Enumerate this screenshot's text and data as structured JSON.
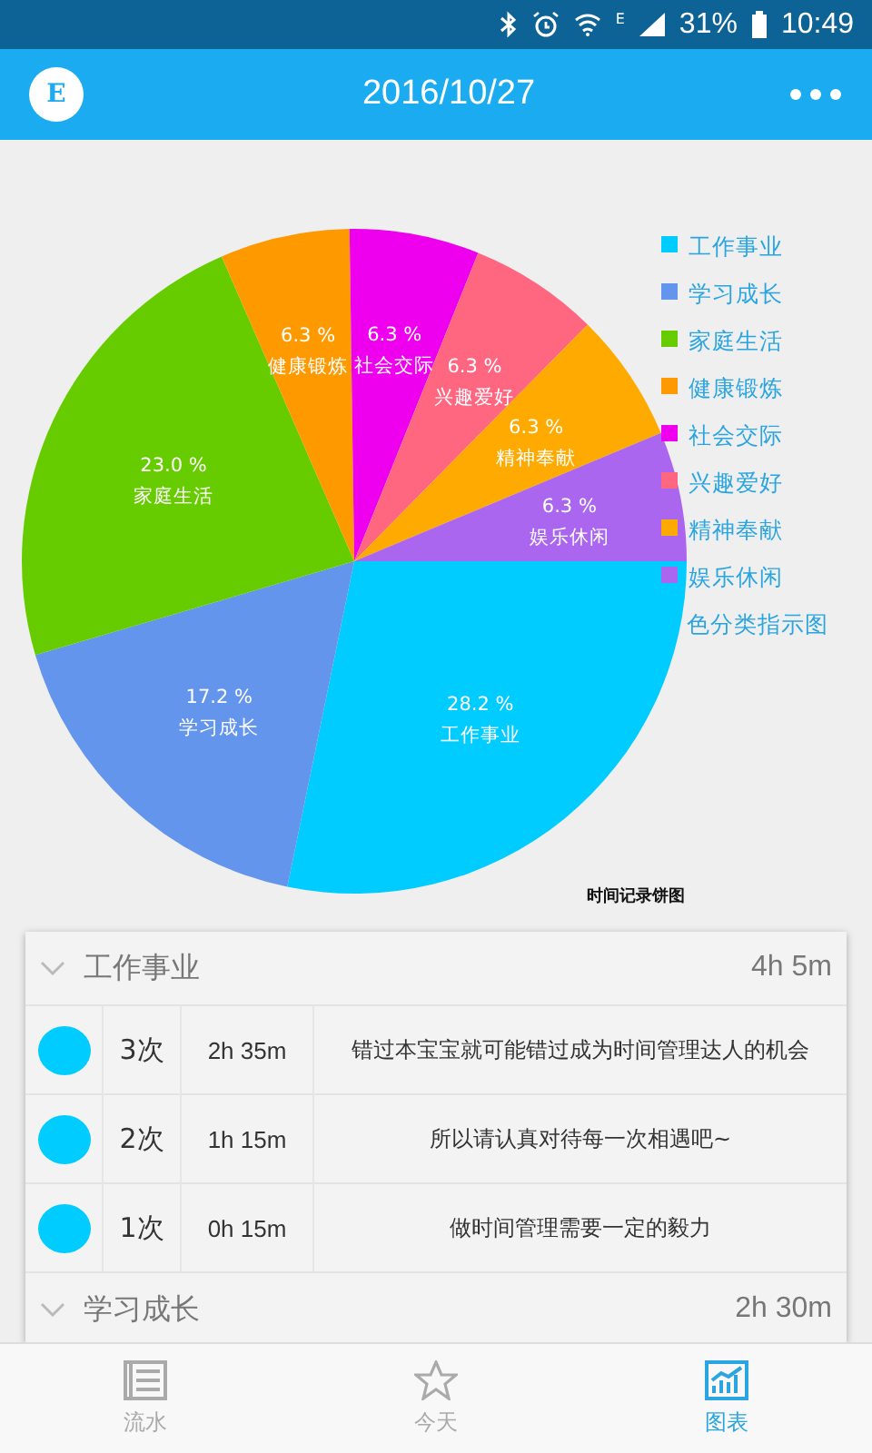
{
  "status_bar": {
    "network_type": "E",
    "battery": "31%",
    "time": "10:49"
  },
  "header": {
    "logo_letter": "E",
    "title": "2016/10/27"
  },
  "chart": {
    "chart_data": {
      "type": "pie",
      "title": "时间记录饼图",
      "categories": [
        "工作事业",
        "学习成长",
        "家庭生活",
        "健康锻炼",
        "社会交际",
        "兴趣爱好",
        "精神奉献",
        "娱乐休闲"
      ],
      "values": [
        28.2,
        17.2,
        23.0,
        6.3,
        6.3,
        6.3,
        6.3,
        6.3
      ],
      "value_labels": [
        "28.2 %",
        "17.2 %",
        "23.0 %",
        "6.3 %",
        "6.3 %",
        "6.3 %",
        "6.3 %",
        "6.3 %"
      ],
      "data_labels": true
    },
    "legend": [
      {
        "label": "工作事业",
        "color": "#00ccff"
      },
      {
        "label": "学习成长",
        "color": "#6495ed"
      },
      {
        "label": "家庭生活",
        "color": "#66cc00"
      },
      {
        "label": "健康锻炼",
        "color": "#ff9900"
      },
      {
        "label": "社会交际",
        "color": "#ee00ee"
      },
      {
        "label": "兴趣爱好",
        "color": "#ff6680"
      },
      {
        "label": "精神奉献",
        "color": "#ffaa00"
      },
      {
        "label": "娱乐休闲",
        "color": "#aa66ee"
      }
    ],
    "legend_title": "色分类指示图"
  },
  "sections": [
    {
      "title": "工作事业",
      "total": "4h 5m",
      "entries": [
        {
          "count": "3次",
          "duration": "2h 35m",
          "note": "错过本宝宝就可能错过成为时间管理达人的机会"
        },
        {
          "count": "2次",
          "duration": "1h 15m",
          "note": "所以请认真对待每一次相遇吧~"
        },
        {
          "count": "1次",
          "duration": "0h 15m",
          "note": "做时间管理需要一定的毅力"
        }
      ]
    },
    {
      "title": "学习成长",
      "total": "2h 30m"
    }
  ],
  "bottom_nav": [
    {
      "label": "流水",
      "kind": "list",
      "selected": false
    },
    {
      "label": "今天",
      "kind": "star",
      "selected": false
    },
    {
      "label": "图表",
      "kind": "chart",
      "selected": true
    }
  ]
}
